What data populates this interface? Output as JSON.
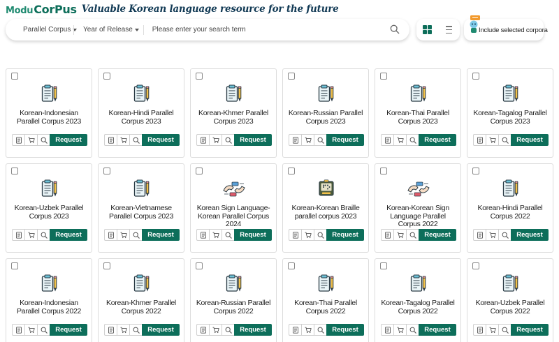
{
  "header": {
    "logo_part1": "Modu",
    "logo_part2": "CorPus",
    "tagline": "Valuable Korean language resource for the future"
  },
  "search": {
    "category_value": "Parallel Corpus",
    "year_value": "Year of Release",
    "placeholder": "Please enter your search term"
  },
  "include_selected_label": "Include selected corpora",
  "request_label": "Request",
  "colors": {
    "accent": "#0d6e5a",
    "brand_navy": "#123a55"
  },
  "corpora": [
    {
      "title": "Korean-Indonesian Parallel Corpus 2023",
      "icon": "clipboard-icon"
    },
    {
      "title": "Korean-Hindi Parallel Corpus 2023",
      "icon": "clipboard-icon"
    },
    {
      "title": "Korean-Khmer Parallel Corpus 2023",
      "icon": "clipboard-icon"
    },
    {
      "title": "Korean-Russian Parallel Corpus 2023",
      "icon": "clipboard-icon"
    },
    {
      "title": "Korean-Thai Parallel Corpus 2023",
      "icon": "clipboard-icon"
    },
    {
      "title": "Korean-Tagalog Parallel Corpus 2023",
      "icon": "clipboard-icon"
    },
    {
      "title": "Korean-Uzbek Parallel Corpus 2023",
      "icon": "clipboard-icon"
    },
    {
      "title": "Korean-Vietnamese Parallel Corpus 2023",
      "icon": "clipboard-icon"
    },
    {
      "title": "Korean Sign Language-Korean Parallel Corpus 2024",
      "icon": "sign-language-icon"
    },
    {
      "title": "Korean-Korean Braille parallel corpus 2023",
      "icon": "braille-icon"
    },
    {
      "title": "Korean-Korean Sign Language Parallel Corpus 2022",
      "icon": "sign-language-icon"
    },
    {
      "title": "Korean-Hindi Parallel Corpus 2022",
      "icon": "clipboard-icon"
    },
    {
      "title": "Korean-Indonesian Parallel Corpus 2022",
      "icon": "clipboard-icon"
    },
    {
      "title": "Korean-Khmer Parallel Corpus 2022",
      "icon": "clipboard-icon"
    },
    {
      "title": "Korean-Russian Parallel Corpus 2022",
      "icon": "clipboard-icon"
    },
    {
      "title": "Korean-Thai Parallel Corpus 2022",
      "icon": "clipboard-icon"
    },
    {
      "title": "Korean-Tagalog Parallel Corpus 2022",
      "icon": "clipboard-icon"
    },
    {
      "title": "Korean-Uzbek Parallel Corpus 2022",
      "icon": "clipboard-icon"
    }
  ]
}
